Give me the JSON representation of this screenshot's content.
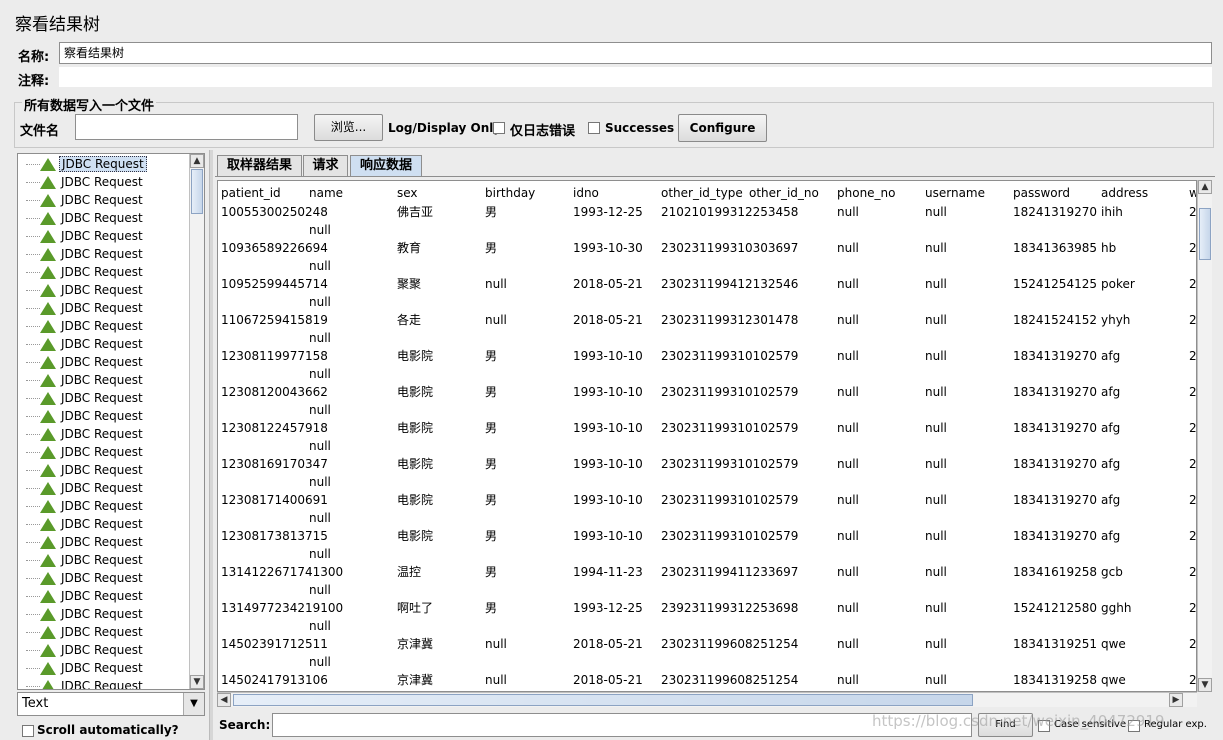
{
  "window": {
    "title": "察看结果树"
  },
  "form": {
    "name_label": "名称:",
    "name_value": "察看结果树",
    "comment_label": "注释:",
    "file_group_label": "所有数据写入一个文件",
    "file_label": "文件名",
    "browse_label": "浏览...",
    "log_display_label": "Log/Display Only:",
    "errors_only_label": "仅日志错误",
    "successes_label": "Successes",
    "configure_label": "Configure"
  },
  "tree": {
    "items": [
      "JDBC Request",
      "JDBC Request",
      "JDBC Request",
      "JDBC Request",
      "JDBC Request",
      "JDBC Request",
      "JDBC Request",
      "JDBC Request",
      "JDBC Request",
      "JDBC Request",
      "JDBC Request",
      "JDBC Request",
      "JDBC Request",
      "JDBC Request",
      "JDBC Request",
      "JDBC Request",
      "JDBC Request",
      "JDBC Request",
      "JDBC Request",
      "JDBC Request",
      "JDBC Request",
      "JDBC Request",
      "JDBC Request",
      "JDBC Request",
      "JDBC Request",
      "JDBC Request",
      "JDBC Request",
      "JDBC Request",
      "JDBC Request",
      "JDBC Request"
    ],
    "renderer_value": "Text",
    "scroll_auto_label": "Scroll automatically?"
  },
  "tabs": [
    "取样器结果",
    "请求",
    "响应数据"
  ],
  "table": {
    "headers": [
      "patient_id",
      "name",
      "sex",
      "birthday",
      "idno",
      "other_id_type",
      "other_id_no",
      "phone_no",
      "username",
      "password",
      "address",
      "w"
    ],
    "rows": [
      [
        "10055300250248",
        "佛吉亚",
        "男",
        "1993-12-25",
        "210210199312253458",
        "null",
        "null",
        "18241319270",
        "ihih",
        "2"
      ],
      [
        "10936589226694",
        "教育",
        "男",
        "1993-10-30",
        "230231199310303697",
        "null",
        "null",
        "18341363985",
        "hb",
        "2"
      ],
      [
        "10952599445714",
        "聚聚",
        "null",
        "2018-05-21",
        "230231199412132546",
        "null",
        "null",
        "15241254125",
        "poker",
        "2"
      ],
      [
        "11067259415819",
        "各走",
        "null",
        "2018-05-21",
        "230231199312301478",
        "null",
        "null",
        "18241524152",
        "yhyh",
        "2"
      ],
      [
        "12308119977158",
        "电影院",
        "男",
        "1993-10-10",
        "230231199310102579",
        "null",
        "null",
        "18341319270",
        "afg",
        "2"
      ],
      [
        "12308120043662",
        "电影院",
        "男",
        "1993-10-10",
        "230231199310102579",
        "null",
        "null",
        "18341319270",
        "afg",
        "2"
      ],
      [
        "12308122457918",
        "电影院",
        "男",
        "1993-10-10",
        "230231199310102579",
        "null",
        "null",
        "18341319270",
        "afg",
        "2"
      ],
      [
        "12308169170347",
        "电影院",
        "男",
        "1993-10-10",
        "230231199310102579",
        "null",
        "null",
        "18341319270",
        "afg",
        "2"
      ],
      [
        "12308171400691",
        "电影院",
        "男",
        "1993-10-10",
        "230231199310102579",
        "null",
        "null",
        "18341319270",
        "afg",
        "2"
      ],
      [
        "12308173813715",
        "电影院",
        "男",
        "1993-10-10",
        "230231199310102579",
        "null",
        "null",
        "18341319270",
        "afg",
        "2"
      ],
      [
        "1314122671741300",
        "温控",
        "男",
        "1994-11-23",
        "230231199411233697",
        "null",
        "null",
        "18341619258",
        "gcb",
        "2"
      ],
      [
        "1314977234219100",
        "啊吐了",
        "男",
        "1993-12-25",
        "239231199312253698",
        "null",
        "null",
        "15241212580",
        "gghh",
        "2"
      ],
      [
        "14502391712511",
        "京津冀",
        "null",
        "2018-05-21",
        "230231199608251254",
        "null",
        "null",
        "18341319251",
        "qwe",
        "2"
      ],
      [
        "14502417913106",
        "京津冀",
        "null",
        "2018-05-21",
        "230231199608251254",
        "null",
        "null",
        "18341319258",
        "qwe",
        "2"
      ]
    ],
    "continuation": "null"
  },
  "search": {
    "label": "Search:",
    "find_label": "Find",
    "case_label": "Case sensitive",
    "regex_label": "Regular exp."
  },
  "watermark": "https://blog.csdn.net/weixin_40472919"
}
